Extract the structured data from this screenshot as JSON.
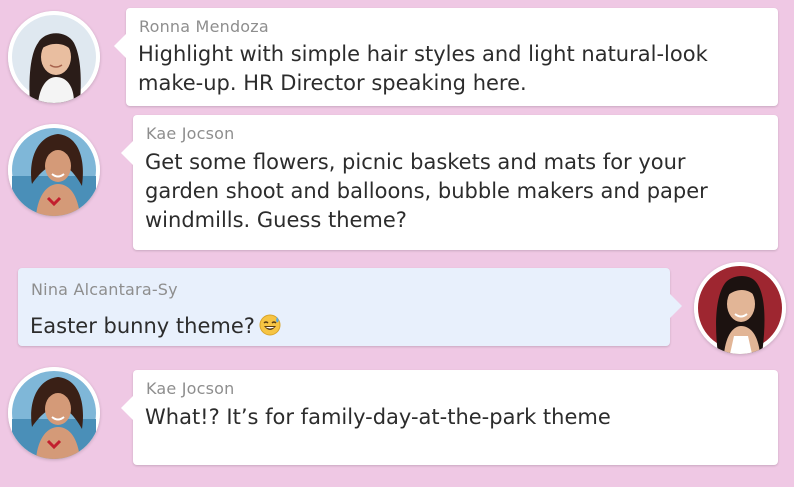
{
  "colors": {
    "background": "#efc8e4",
    "incoming_bubble": "#ffffff",
    "outgoing_bubble": "#e8f0fc",
    "sender_text": "#8e8e8e",
    "message_text": "#2c2c2c"
  },
  "messages": [
    {
      "sender": "Ronna Mendoza",
      "text": "Highlight with simple hair styles and light natural-look make-up. HR Director speaking here.",
      "direction": "incoming",
      "avatar": "ronna-avatar-icon"
    },
    {
      "sender": "Kae Jocson",
      "text": "Get some flowers, picnic baskets and mats for your garden shoot and balloons, bubble makers and paper windmills. Guess theme?",
      "direction": "incoming",
      "avatar": "kae-avatar-icon"
    },
    {
      "sender": "Nina Alcantara-Sy",
      "text": "Easter bunny theme?",
      "emoji": "sweat-smile-emoji-icon",
      "direction": "outgoing",
      "avatar": "nina-avatar-icon"
    },
    {
      "sender": "Kae Jocson",
      "text": "What!? It’s for family-day-at-the-park theme",
      "direction": "incoming",
      "avatar": "kae-avatar-icon"
    }
  ]
}
